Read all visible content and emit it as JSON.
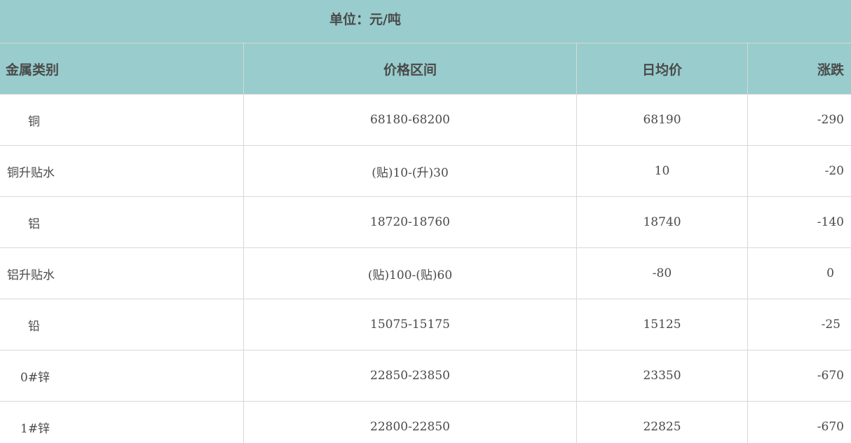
{
  "unit_label": "单位：元/吨",
  "headers": [
    "金属类别",
    "价格区间",
    "日均价",
    "涨跌"
  ],
  "rows": [
    {
      "metal": "铜",
      "range": "68180-68200",
      "avg": "68190",
      "change": "-290"
    },
    {
      "metal": "铜升贴水",
      "range": "(贴)10-(升)30",
      "avg": "10",
      "change": "-20"
    },
    {
      "metal": "铝",
      "range": "18720-18760",
      "avg": "18740",
      "change": "-140"
    },
    {
      "metal": "铝升贴水",
      "range": "(贴)100-(贴)60",
      "avg": "-80",
      "change": "0"
    },
    {
      "metal": "铅",
      "range": "15075-15175",
      "avg": "15125",
      "change": "-25"
    },
    {
      "metal": "0#锌",
      "range": "22850-23850",
      "avg": "23350",
      "change": "-670"
    },
    {
      "metal": "1#锌",
      "range": "22800-22850",
      "avg": "22825",
      "change": "-670"
    }
  ]
}
